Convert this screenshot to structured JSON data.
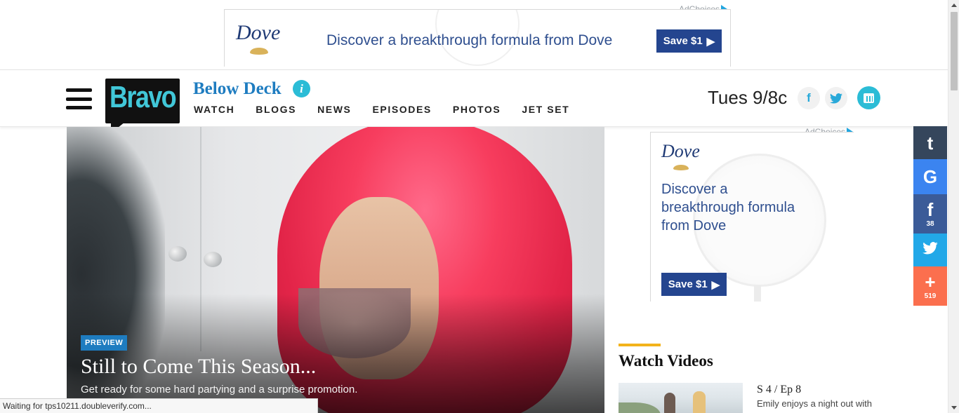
{
  "top_ad": {
    "adchoices": "AdChoices",
    "brand": "Dove",
    "headline": "Discover a breakthrough formula from Dove",
    "cta": "Save $1"
  },
  "header": {
    "logo": "Bravo",
    "show_title": "Below Deck",
    "nav": [
      "WATCH",
      "BLOGS",
      "NEWS",
      "EPISODES",
      "PHOTOS",
      "JET SET"
    ],
    "airtime": "Tues 9/8c"
  },
  "hero": {
    "badge": "PREVIEW",
    "title": "Still to Come This Season...",
    "subtitle": "Get ready for some hard partying and a surprise promotion."
  },
  "side_ad": {
    "adchoices": "AdChoices",
    "brand": "Dove",
    "headline": "Discover a breakthrough formula from Dove",
    "cta": "Save $1"
  },
  "watch_videos": {
    "heading": "Watch Videos",
    "items": [
      {
        "episode": "S 4 / Ep 8",
        "description": "Emily enjoys a night out with"
      }
    ]
  },
  "share_rail": {
    "tumblr": {
      "icon": "tumblr-icon",
      "glyph": "t"
    },
    "google": {
      "icon": "google-icon",
      "glyph": "G"
    },
    "facebook": {
      "icon": "facebook-icon",
      "glyph": "f",
      "count": "38"
    },
    "twitter": {
      "icon": "twitter-icon"
    },
    "more": {
      "icon": "plus-icon",
      "glyph": "+",
      "count": "519"
    }
  },
  "status_bar": {
    "text": "Waiting for tps10211.doubleverify.com..."
  },
  "colors": {
    "brand_blue": "#1e7cc0",
    "teal": "#2bbcd6",
    "ad_navy": "#24458f",
    "accent_yellow": "#f3b31b"
  }
}
